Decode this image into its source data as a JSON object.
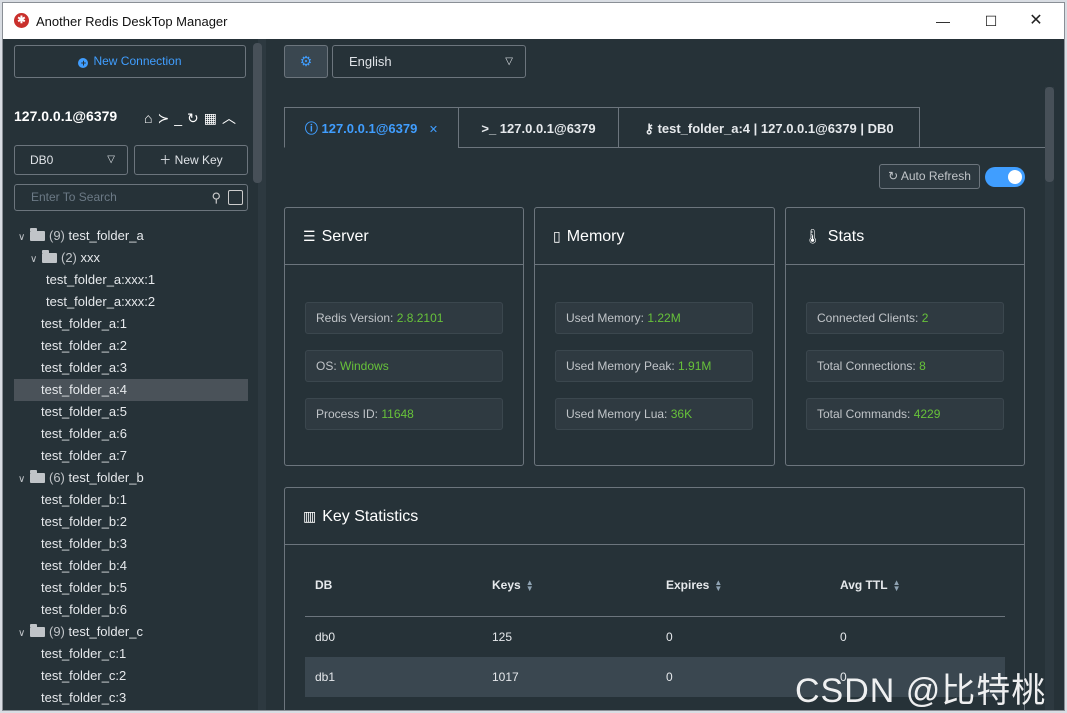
{
  "window": {
    "title": "Another Redis DeskTop Manager",
    "controls": {
      "minimize": "—",
      "maximize": "☐",
      "close": "✕"
    }
  },
  "sidebar": {
    "new_connection": "New Connection",
    "connection_name": "127.0.0.1@6379",
    "db_select": "DB0",
    "new_key": "New Key",
    "search_placeholder": "Enter To Search",
    "tree": [
      {
        "type": "folder",
        "level": 0,
        "count": "(9)",
        "label": "test_folder_a"
      },
      {
        "type": "folder",
        "level": 1,
        "count": "(2)",
        "label": "xxx"
      },
      {
        "type": "key",
        "level": 2,
        "label": "test_folder_a:xxx:1"
      },
      {
        "type": "key",
        "level": 2,
        "label": "test_folder_a:xxx:2"
      },
      {
        "type": "key",
        "level": 1,
        "label": "test_folder_a:1"
      },
      {
        "type": "key",
        "level": 1,
        "label": "test_folder_a:2"
      },
      {
        "type": "key",
        "level": 1,
        "label": "test_folder_a:3"
      },
      {
        "type": "key",
        "level": 1,
        "label": "test_folder_a:4",
        "selected": true
      },
      {
        "type": "key",
        "level": 1,
        "label": "test_folder_a:5"
      },
      {
        "type": "key",
        "level": 1,
        "label": "test_folder_a:6"
      },
      {
        "type": "key",
        "level": 1,
        "label": "test_folder_a:7"
      },
      {
        "type": "folder",
        "level": 0,
        "count": "(6)",
        "label": "test_folder_b"
      },
      {
        "type": "key",
        "level": 1,
        "label": "test_folder_b:1"
      },
      {
        "type": "key",
        "level": 1,
        "label": "test_folder_b:2"
      },
      {
        "type": "key",
        "level": 1,
        "label": "test_folder_b:3"
      },
      {
        "type": "key",
        "level": 1,
        "label": "test_folder_b:4"
      },
      {
        "type": "key",
        "level": 1,
        "label": "test_folder_b:5"
      },
      {
        "type": "key",
        "level": 1,
        "label": "test_folder_b:6"
      },
      {
        "type": "folder",
        "level": 0,
        "count": "(9)",
        "label": "test_folder_c"
      },
      {
        "type": "key",
        "level": 1,
        "label": "test_folder_c:1"
      },
      {
        "type": "key",
        "level": 1,
        "label": "test_folder_c:2"
      },
      {
        "type": "key",
        "level": 1,
        "label": "test_folder_c:3"
      }
    ]
  },
  "toolbar": {
    "language": "English"
  },
  "tabs": [
    {
      "label": "127.0.0.1@6379",
      "icon": "info-icon",
      "active": true
    },
    {
      "label": ">_ 127.0.0.1@6379",
      "icon": "terminal-icon"
    },
    {
      "label": "test_folder_a:4 | 127.0.0.1@6379 | DB0",
      "icon": "key-icon"
    }
  ],
  "auto_refresh": {
    "label": "Auto Refresh",
    "enabled": true
  },
  "server": {
    "title": "Server",
    "redis_version_label": "Redis Version: ",
    "redis_version": "2.8.2101",
    "os_label": "OS: ",
    "os": "Windows",
    "process_id_label": "Process ID: ",
    "process_id": "11648"
  },
  "memory": {
    "title": "Memory",
    "used_label": "Used Memory: ",
    "used": "1.22M",
    "peak_label": "Used Memory Peak: ",
    "peak": "1.91M",
    "lua_label": "Used Memory Lua: ",
    "lua": "36K"
  },
  "stats": {
    "title": "Stats",
    "clients_label": "Connected Clients: ",
    "clients": "2",
    "connections_label": "Total Connections: ",
    "connections": "8",
    "commands_label": "Total Commands: ",
    "commands": "4229"
  },
  "key_statistics": {
    "title": "Key Statistics",
    "columns": [
      "DB",
      "Keys",
      "Expires",
      "Avg TTL"
    ],
    "rows": [
      [
        "db0",
        "125",
        "0",
        "0"
      ],
      [
        "db1",
        "1017",
        "0",
        "0"
      ]
    ]
  },
  "watermark": "CSDN @比特桃",
  "colors": {
    "accent": "#409eff",
    "value": "#67c23a",
    "background": "#263238"
  }
}
